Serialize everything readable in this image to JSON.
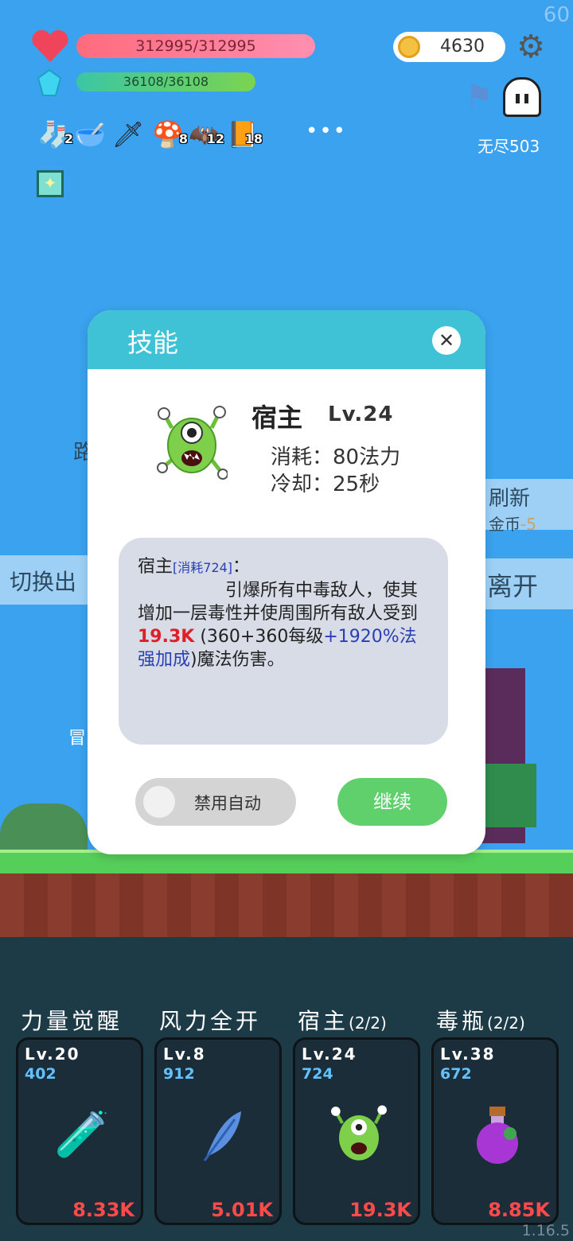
{
  "hud": {
    "fps": "60",
    "hp": "312995/312995",
    "mp": "36108/36108",
    "gold": "4630",
    "mode_label": "无尽503"
  },
  "inventory": [
    {
      "icon": "sock-icon",
      "glyph": "🧦",
      "count": "2"
    },
    {
      "icon": "mortar-icon",
      "glyph": "🥣",
      "count": ""
    },
    {
      "icon": "sword-icon",
      "glyph": "🗡",
      "count": ""
    },
    {
      "icon": "mushroom-icon",
      "glyph": "🍄",
      "count": "8"
    },
    {
      "icon": "bat-icon",
      "glyph": "🦇",
      "count": "12"
    },
    {
      "icon": "book-icon",
      "glyph": "📙",
      "count": "18"
    }
  ],
  "more_label": "•••",
  "background": {
    "refresh_label": "刷新",
    "refresh_cost_prefix": "金币",
    "refresh_cost_value": "-5",
    "leave_label": "离开",
    "switch_label": "切换出",
    "road_label": "路",
    "adventure_label": "冒"
  },
  "modal": {
    "title": "技能",
    "skill_name": "宿主",
    "skill_level": "Lv.24",
    "cost": "消耗：80法力",
    "cooldown": "冷却：25秒",
    "desc_name": "宿主",
    "desc_cost_tag": "[消耗724]",
    "desc_colon": "：",
    "desc_line1": "引爆所有中毒敌人，使其增加一层毒性并使周围所有敌人受到",
    "desc_damage": "19.3K",
    "desc_formula": "(360+360每级",
    "desc_bonus": "+1920%法强加成",
    "desc_tail": ")魔法伤害。",
    "toggle_label": "禁用自动",
    "continue_label": "继续"
  },
  "skills": [
    {
      "name": "力量觉醒",
      "count": "",
      "level": "Lv.20",
      "mp": "402",
      "damage": "8.33K",
      "icon": "potion-tube-icon",
      "glyph": "🧪"
    },
    {
      "name": "风力全开",
      "count": "",
      "level": "Lv.8",
      "mp": "912",
      "damage": "5.01K",
      "icon": "feather-icon",
      "glyph": "🪶"
    },
    {
      "name": "宿主",
      "count": "(2/2)",
      "level": "Lv.24",
      "mp": "724",
      "damage": "19.3K",
      "icon": "host-monster-icon",
      "glyph": "👾"
    },
    {
      "name": "毒瓶",
      "count": "(2/2)",
      "level": "Lv.38",
      "mp": "672",
      "damage": "8.85K",
      "icon": "poison-bottle-icon",
      "glyph": "⚗"
    }
  ],
  "version": "1.16.5",
  "colors": {
    "sky": "#3aa2ee",
    "modal_header": "#3fc2d6",
    "continue": "#5fd06c",
    "damage": "#ff4a4a",
    "mp": "#62c1ff"
  }
}
